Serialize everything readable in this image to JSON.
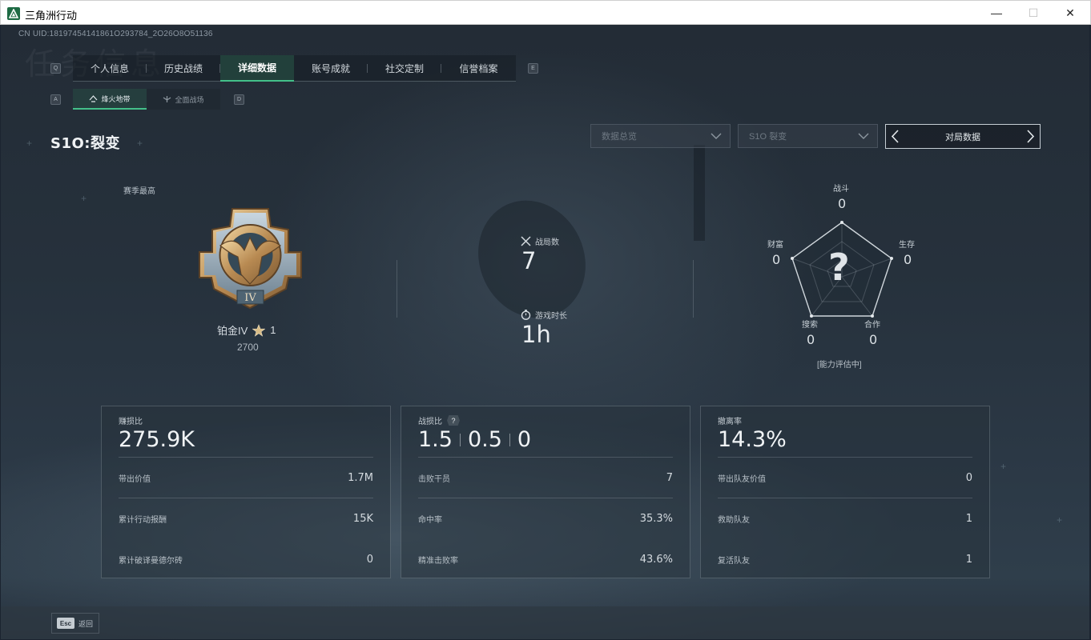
{
  "window": {
    "title": "三角洲行动",
    "minimize": "—",
    "maximize": "☐",
    "close": "✕"
  },
  "uid": "CN UID:18197454141861O293784_2O26O8O51136",
  "background_text": "任务信息",
  "tabs": {
    "prev_key": "Q",
    "next_key": "E",
    "items": [
      {
        "label": "个人信息",
        "active": false
      },
      {
        "label": "历史战绩",
        "active": false
      },
      {
        "label": "详细数据",
        "active": true
      },
      {
        "label": "账号成就",
        "active": false
      },
      {
        "label": "社交定制",
        "active": false
      },
      {
        "label": "信誉档案",
        "active": false
      }
    ]
  },
  "subtabs": {
    "prev_key": "A",
    "next_key": "D",
    "items": [
      {
        "label": "烽火地带",
        "icon": "flame-zone-icon",
        "active": true
      },
      {
        "label": "全面战场",
        "icon": "battlefield-icon",
        "active": false
      }
    ]
  },
  "season": {
    "title": "S1O:裂变"
  },
  "filters": {
    "overview": "数据总览",
    "season": "S1O 裂变",
    "switcher": "对局数据"
  },
  "rank": {
    "season_best_label": "赛季最高",
    "tier": "铂金IV",
    "stars": "1",
    "score": "2700",
    "medal_numeral": "IV"
  },
  "battles": {
    "count_label": "战局数",
    "count_value": "7",
    "time_label": "游戏时长",
    "time_value": "1h"
  },
  "radar": {
    "center_mark": "?",
    "status": "[能力评估中]",
    "axes": [
      {
        "label": "战斗",
        "value": "0"
      },
      {
        "label": "生存",
        "value": "0"
      },
      {
        "label": "合作",
        "value": "0"
      },
      {
        "label": "搜索",
        "value": "0"
      },
      {
        "label": "财富",
        "value": "0"
      }
    ]
  },
  "cards": [
    {
      "title": "赚损比",
      "big": "275.9K",
      "rows": [
        {
          "k": "带出价值",
          "v": "1.7M"
        },
        {
          "k": "累计行动报酬",
          "v": "15K"
        },
        {
          "k": "累计破译曼德尔砖",
          "v": "0"
        }
      ]
    },
    {
      "title": "战损比",
      "help": "?",
      "ratios": [
        "1.5",
        "0.5",
        "0"
      ],
      "rows": [
        {
          "k": "击败干员",
          "v": "7"
        },
        {
          "k": "命中率",
          "v": "35.3%"
        },
        {
          "k": "精准击败率",
          "v": "43.6%"
        }
      ]
    },
    {
      "title": "撤离率",
      "big": "14.3%",
      "rows": [
        {
          "k": "带出队友价值",
          "v": "0"
        },
        {
          "k": "救助队友",
          "v": "1"
        },
        {
          "k": "复活队友",
          "v": "1"
        }
      ]
    }
  ],
  "footer": {
    "esc_key": "Esc",
    "back_label": "返回"
  }
}
